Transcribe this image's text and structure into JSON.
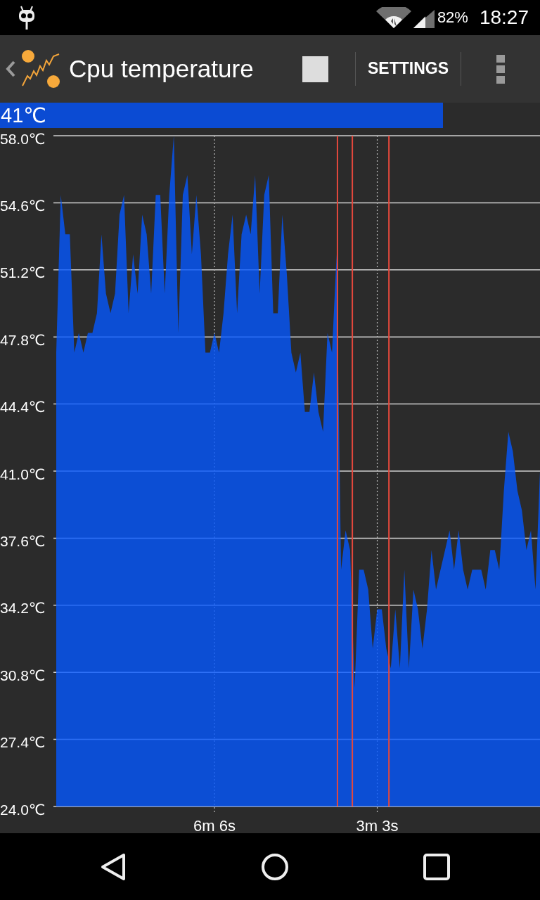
{
  "status_bar": {
    "battery": "82%",
    "time": "18:27"
  },
  "action_bar": {
    "title": "Cpu temperature",
    "actions": [
      "SETTINGS"
    ]
  },
  "current": {
    "reading": "41℃",
    "level": 0.82
  },
  "chart": {
    "chart_data": {
      "type": "area",
      "grid": true,
      "categories": [
        null,
        null,
        null,
        null,
        null,
        null,
        null,
        null,
        null,
        null,
        null,
        null,
        null,
        null,
        null,
        null,
        null,
        null,
        null,
        null,
        null,
        null,
        null,
        null,
        null,
        null,
        null,
        null,
        null,
        null,
        null,
        null,
        null,
        null,
        null,
        "6m 6s",
        null,
        null,
        null,
        null,
        null,
        null,
        null,
        null,
        null,
        null,
        null,
        null,
        null,
        null,
        null,
        null,
        null,
        null,
        null,
        null,
        null,
        null,
        null,
        null,
        null,
        null,
        null,
        null,
        null,
        null,
        null,
        null,
        null,
        null,
        null,
        "3m 3s",
        null,
        null,
        null,
        null,
        null,
        null,
        null,
        null,
        null,
        null,
        null,
        null,
        null,
        null,
        null,
        null,
        null,
        null,
        null,
        null,
        null,
        null,
        null,
        null,
        null,
        null,
        null,
        null,
        null,
        null,
        null,
        null,
        null,
        null,
        null,
        null
      ],
      "series": [
        {
          "color": "#0558ff",
          "values": [
            47,
            55,
            53,
            53,
            47,
            48,
            47,
            48,
            48,
            49,
            53,
            50,
            49,
            50,
            54,
            55,
            49,
            52,
            50,
            54,
            53,
            50,
            55,
            55,
            50,
            55,
            58,
            48,
            55,
            56,
            52,
            55,
            52,
            47,
            47,
            48,
            47,
            49,
            52,
            54,
            49,
            53,
            54,
            53,
            56,
            50,
            55,
            56,
            49,
            49,
            54,
            51,
            47,
            46,
            47,
            44,
            44,
            46,
            44,
            43,
            48,
            47,
            52,
            36,
            38,
            37,
            30,
            36,
            36,
            35,
            32,
            34,
            34,
            32,
            31,
            34,
            31,
            36,
            31,
            35,
            34,
            32,
            34,
            37,
            35,
            36,
            37,
            38,
            36,
            38,
            36,
            35,
            36,
            36,
            36,
            35,
            37,
            37,
            36,
            40,
            43,
            42,
            40,
            39,
            37,
            38,
            35,
            41
          ]
        }
      ],
      "ylim": [
        24,
        58
      ],
      "yticks": [
        {
          "value": 58,
          "label": "58.0℃"
        },
        {
          "value": 54.6,
          "label": "54.6℃"
        },
        {
          "value": 51.2,
          "label": "51.2℃"
        },
        {
          "value": 47.8,
          "label": "47.8℃"
        },
        {
          "value": 44.4,
          "label": "44.4℃"
        },
        {
          "value": 41,
          "label": "41.0℃"
        },
        {
          "value": 37.6,
          "label": "37.6℃"
        },
        {
          "value": 34.2,
          "label": "34.2℃"
        },
        {
          "value": 30.8,
          "label": "30.8℃"
        },
        {
          "value": 27.4,
          "label": "27.4℃"
        },
        {
          "value": 24,
          "label": "24.0℃"
        }
      ]
    }
  }
}
